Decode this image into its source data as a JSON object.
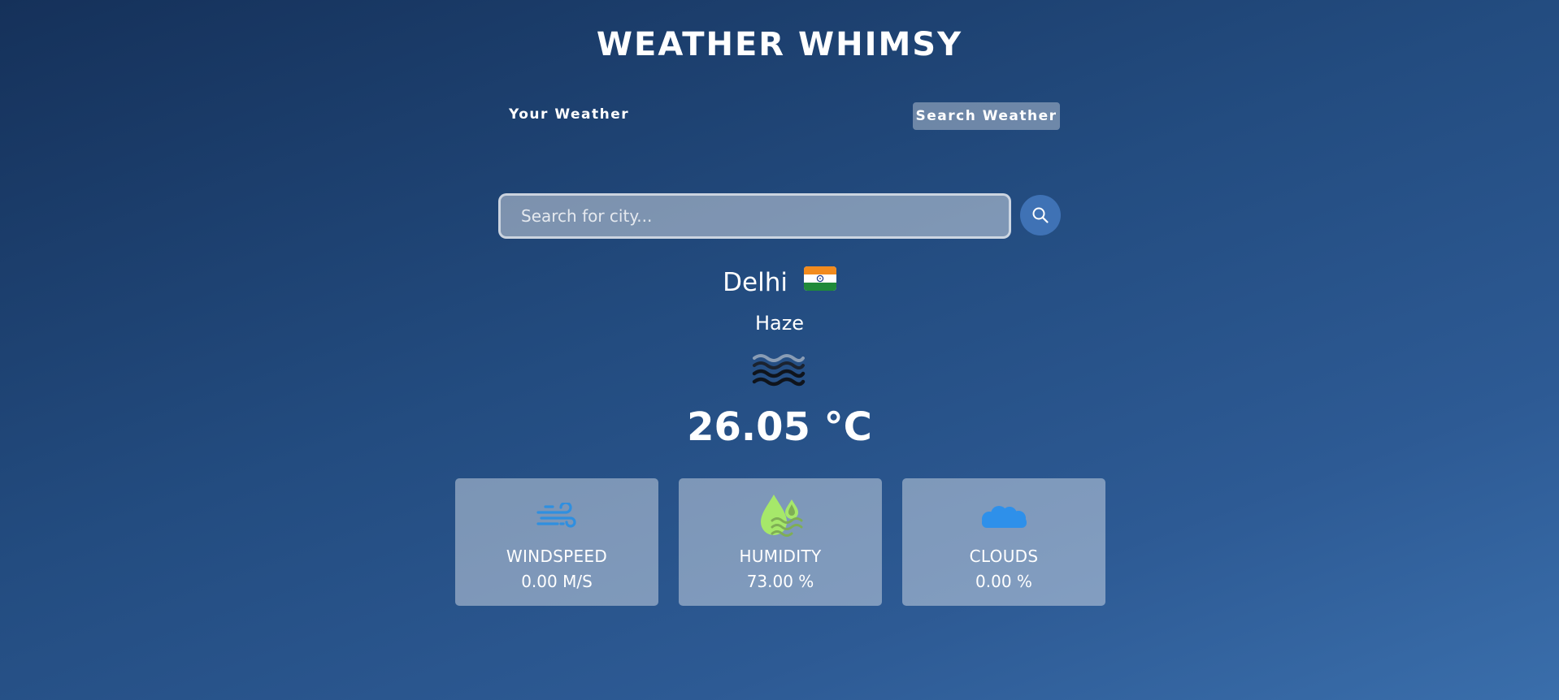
{
  "app": {
    "title": "WEATHER WHIMSY"
  },
  "tabs": {
    "your_weather": "Your Weather",
    "search_weather": "Search Weather"
  },
  "search": {
    "placeholder": "Search for city...",
    "value": ""
  },
  "weather": {
    "city": "Delhi",
    "country_flag": "india-flag-icon",
    "condition": "Haze",
    "condition_icon": "haze-icon",
    "temperature": "26.05 °C"
  },
  "stats": {
    "windspeed": {
      "label": "WINDSPEED",
      "value": "0.00 M/S",
      "icon": "wind-icon"
    },
    "humidity": {
      "label": "HUMIDITY",
      "value": "73.00 %",
      "icon": "humidity-icon"
    },
    "clouds": {
      "label": "CLOUDS",
      "value": "0.00 %",
      "icon": "cloud-icon"
    }
  },
  "colors": {
    "active_tab_bg": "#8da4c4",
    "search_button": "#3f72b5",
    "wind_icon": "#2f8fe0",
    "humidity_icon": "#a6e86a",
    "cloud_icon": "#2e90ea"
  }
}
